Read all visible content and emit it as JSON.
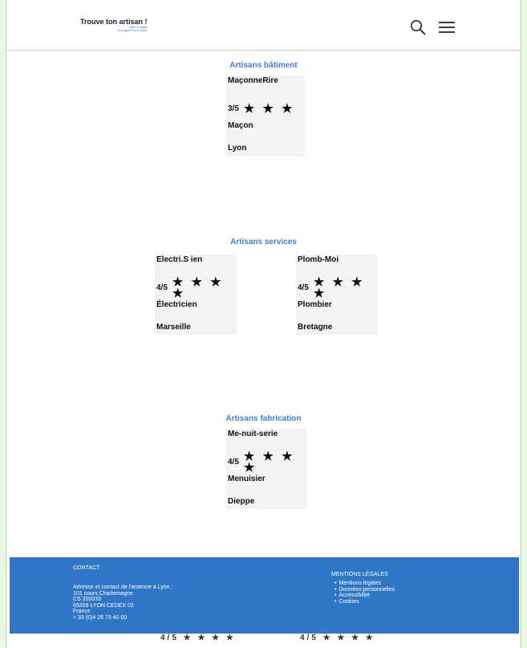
{
  "header": {
    "logo_title": "Trouve ton artisan !",
    "logo_sub1": "Avec la région",
    "logo_sub2": "Auvergne-Rhône-Alpes"
  },
  "sections": [
    {
      "title": "Artisans bâtiment",
      "cards": [
        {
          "name": "MaçonneRire",
          "rating": "3/5",
          "stars": "★ ★ ★",
          "rating_value": 3,
          "trade": "Maçon",
          "city": "Lyon"
        }
      ]
    },
    {
      "title": "Artisans services",
      "cards": [
        {
          "name": "Electri.S ien",
          "rating": "4/5",
          "stars": "★ ★ ★ ★",
          "rating_value": 4,
          "trade": "Électricien",
          "city": "Marseille"
        },
        {
          "name": "Plomb-Moi",
          "rating": "4/5",
          "stars": "★ ★ ★ ★",
          "rating_value": 4,
          "trade": "Plombier",
          "city": "Bretagne"
        }
      ]
    },
    {
      "title": "Artisans fabrication",
      "cards": [
        {
          "name": "Me-nuit-serie",
          "rating": "4/5",
          "stars": "★ ★ ★ ★",
          "rating_value": 4,
          "trade": "Menuisier",
          "city": "Dieppe"
        }
      ]
    }
  ],
  "footer": {
    "contact_title": "CONTACT",
    "contact_lines": [
      "Adresse et contact de l'antenne à Lyon :",
      "101 cours Charlemagne",
      "CS 200033",
      "69269 LYON CEDEX 02",
      "France",
      "+ 33 (0)4 26 73 40 00"
    ],
    "legal_title": "MENTIONS LÉGALES",
    "legal_links": [
      "Mentions légales",
      "Données personnelles",
      "Accessibilité",
      "Cookies"
    ]
  },
  "overflow_ratings": [
    "4/5 ★ ★ ★ ★",
    "4/5 ★ ★ ★ ★"
  ],
  "colors": {
    "accent": "#3f7fd0",
    "footer_bg": "#2f76c6",
    "card_bg": "#f3f3f3",
    "outer_bg": "#ecf7e4"
  },
  "icons": [
    "search-icon",
    "menu-icon",
    "star-icon"
  ]
}
